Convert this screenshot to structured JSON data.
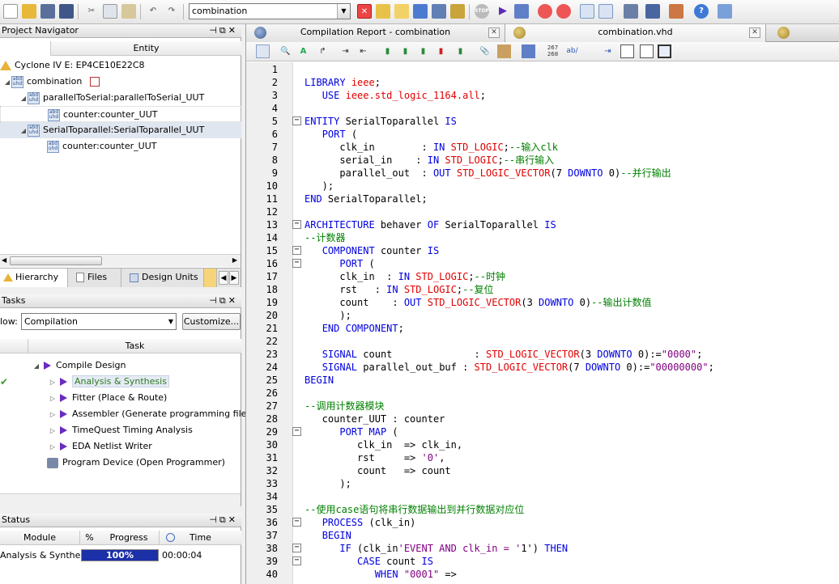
{
  "toolbar": {
    "entity_combo": "combination"
  },
  "project_navigator": {
    "title": "Project Navigator",
    "column_header": "Entity",
    "device": "Cyclone IV E: EP4CE10E22C8",
    "tree": [
      {
        "label": "combination",
        "level": 0
      },
      {
        "label": "parallelToSerial:parallelToSerial_UUT",
        "level": 1
      },
      {
        "label": "counter:counter_UUT",
        "level": 2
      },
      {
        "label": "SerialToparallel:SerialToparallel_UUT",
        "level": 1
      },
      {
        "label": "counter:counter_UUT",
        "level": 2
      }
    ],
    "tabs": [
      "Hierarchy",
      "Files",
      "Design Units"
    ]
  },
  "tasks": {
    "title": "Tasks",
    "flow_label": "low:",
    "flow_value": "Compilation",
    "customize_label": "Customize...",
    "column_header": "Task",
    "items": [
      {
        "label": "Compile Design",
        "status": "",
        "active": false
      },
      {
        "label": "Analysis & Synthesis",
        "status": "✔",
        "active": true
      },
      {
        "label": "Fitter (Place & Route)",
        "status": "",
        "active": false
      },
      {
        "label": "Assembler (Generate programming files)",
        "status": "",
        "active": false
      },
      {
        "label": "TimeQuest Timing Analysis",
        "status": "",
        "active": false
      },
      {
        "label": "EDA Netlist Writer",
        "status": "",
        "active": false
      },
      {
        "label": "Program Device (Open Programmer)",
        "status": "",
        "active": false
      }
    ]
  },
  "status_panel": {
    "title": "Status",
    "headers": [
      "Module",
      "%",
      "Progress",
      "Time"
    ],
    "rows": [
      {
        "module": "Analysis & Synthesis",
        "progress": "100%",
        "progress_fraction": 1.0,
        "time": "00:00:04"
      }
    ]
  },
  "editor": {
    "tabs": [
      {
        "label": "Compilation Report - combination"
      },
      {
        "label": "combination.vhd"
      }
    ],
    "code_lines": [
      "",
      "LIBRARY ieee;",
      "   USE ieee.std_logic_1164.all;",
      "",
      "ENTITY SerialToparallel IS",
      "   PORT (",
      "      clk_in        : IN STD_LOGIC;--输入clk",
      "      serial_in    : IN STD_LOGIC;--串行输入",
      "      parallel_out  : OUT STD_LOGIC_VECTOR(7 DOWNTO 0)--并行输出",
      "   );",
      "END SerialToparallel;",
      "",
      "ARCHITECTURE behaver OF SerialToparallel IS",
      "--计数器",
      "   COMPONENT counter IS",
      "      PORT (",
      "      clk_in  : IN STD_LOGIC;--时钟",
      "      rst   : IN STD_LOGIC;--复位",
      "      count    : OUT STD_LOGIC_VECTOR(3 DOWNTO 0)--输出计数值",
      "      );",
      "   END COMPONENT;",
      "",
      "   SIGNAL count              : STD_LOGIC_VECTOR(3 DOWNTO 0):=\"0000\";",
      "   SIGNAL parallel_out_buf : STD_LOGIC_VECTOR(7 DOWNTO 0):=\"00000000\";",
      "BEGIN",
      "",
      "--调用计数器模块",
      "   counter_UUT : counter",
      "      PORT MAP (",
      "         clk_in  => clk_in,",
      "         rst     => '0',",
      "         count   => count",
      "      );",
      "",
      "--使用case语句将串行数据输出到并行数据对应位",
      "   PROCESS (clk_in)",
      "   BEGIN",
      "      IF (clk_in'EVENT AND clk_in = '1') THEN",
      "         CASE count IS",
      "            WHEN \"0001\" =>"
    ]
  }
}
